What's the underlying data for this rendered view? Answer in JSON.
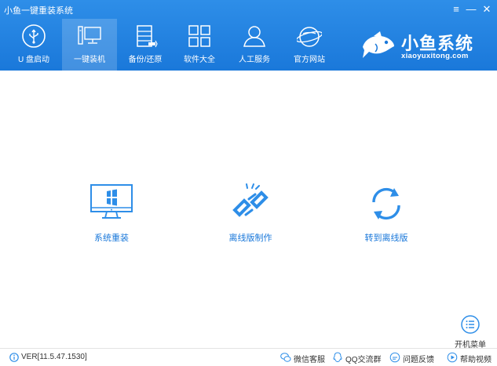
{
  "window": {
    "title": "小鱼一键重装系统"
  },
  "window_controls": {
    "menu": "≡",
    "minimize": "—",
    "close": "✕"
  },
  "nav": {
    "tabs": [
      {
        "label": "U 盘启动",
        "icon": "usb-icon"
      },
      {
        "label": "一键装机",
        "icon": "computer-icon",
        "active": true
      },
      {
        "label": "备份/还原",
        "icon": "backup-icon"
      },
      {
        "label": "软件大全",
        "icon": "apps-grid-icon"
      },
      {
        "label": "人工服务",
        "icon": "user-service-icon"
      },
      {
        "label": "官方网站",
        "icon": "globe-icon"
      }
    ]
  },
  "brand": {
    "name": "小鱼系统",
    "url": "xiaoyuxitong.com",
    "logo": "fish-logo-icon"
  },
  "actions": [
    {
      "label": "系统重装",
      "icon": "windows-monitor-icon"
    },
    {
      "label": "离线版制作",
      "icon": "link-broken-icon"
    },
    {
      "label": "转到离线版",
      "icon": "refresh-cycle-icon"
    }
  ],
  "boot_menu": {
    "label": "开机菜单",
    "icon": "list-menu-icon"
  },
  "status": {
    "version": "VER[11.5.47.1530]",
    "links": [
      {
        "label": "微信客服",
        "icon": "wechat-icon"
      },
      {
        "label": "QQ交流群",
        "icon": "qq-icon"
      },
      {
        "label": "问题反馈",
        "icon": "feedback-icon"
      },
      {
        "label": "帮助视频",
        "icon": "help-video-icon"
      }
    ]
  },
  "colors": {
    "header": "#1a78da",
    "accent": "#1a78da",
    "icon_blue": "#2e8ee8"
  }
}
